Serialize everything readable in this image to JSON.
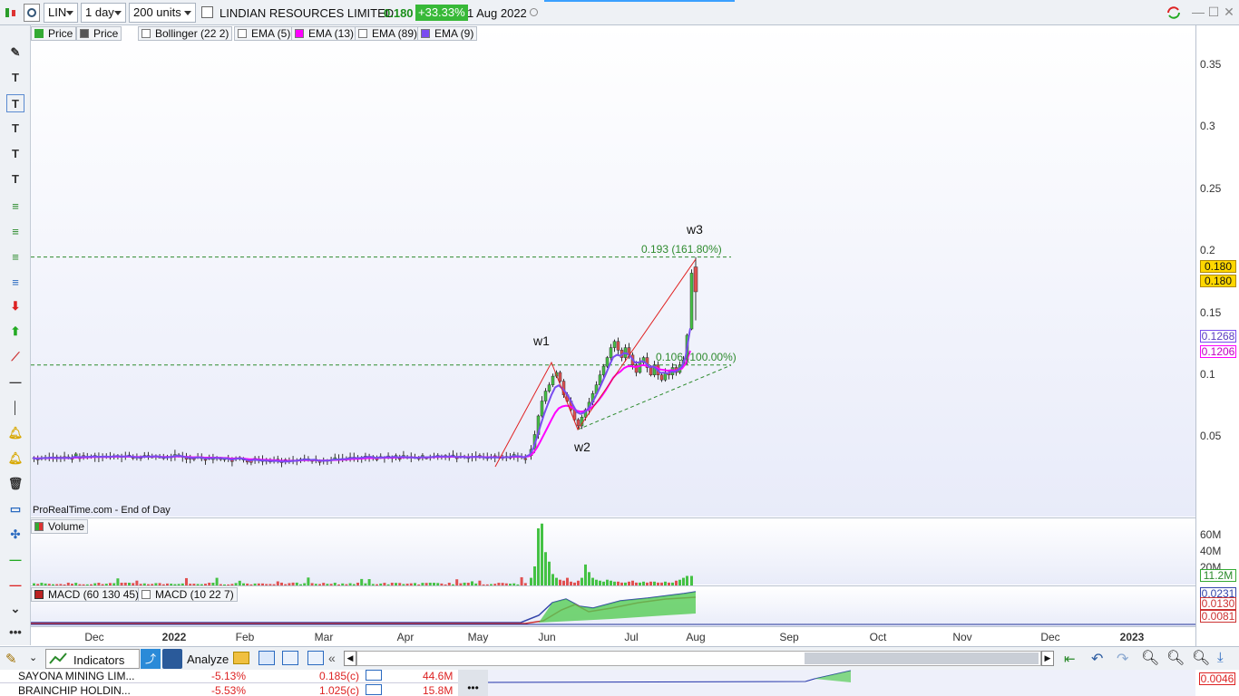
{
  "toolbar": {
    "symbol": "LIN",
    "interval": "1 day",
    "units": "200 units",
    "instrument_name": "LINDIAN RESOURCES LIMITED",
    "last_price": "0.180",
    "change_pct": "+33.33%",
    "date": "1 Aug 2022"
  },
  "chart_legend": [
    "Price",
    "Price",
    "Bollinger (22 2)",
    "EMA (5)",
    "EMA (13)",
    "EMA (89)",
    "EMA (9)"
  ],
  "source_label": "ProRealTime.com - End of Day",
  "volume_panel": {
    "label": "Volume",
    "axis_labels": [
      "60M",
      "40M",
      "20M"
    ],
    "current_tag": "11.2M"
  },
  "macd_panel": {
    "labels": [
      "MACD (60 130 45)",
      "MACD (10 22 7)"
    ],
    "tags": [
      "0.0231",
      "0.0130",
      "0.0081"
    ]
  },
  "annotations": {
    "w1": "w1",
    "w2": "w2",
    "w3": "w3",
    "fib_upper": "0.193 (161.80%)",
    "fib_lower": "0.106 (100.00%)"
  },
  "price_tags": {
    "last1": "0.180",
    "last2": "0.180",
    "ema1": "0.1268",
    "ema2": "0.1206"
  },
  "bottom_toolbar": {
    "indicators": "Indicators",
    "analyze": "Analyze"
  },
  "watchlist": [
    {
      "name": "SAYONA MINING LIM...",
      "change": "-5.13%",
      "price": "0.185(c)",
      "volume": "44.6M"
    },
    {
      "name": "BRAINCHIP HOLDIN...",
      "change": "-5.53%",
      "price": "1.025(c)",
      "volume": "15.8M"
    }
  ],
  "secondary_tag": "0.0046",
  "colors": {
    "ema5": "#7a4cf0",
    "ema13": "#ff00ff",
    "up": "#44c244",
    "down": "#e05050",
    "fib": "#2e8b2e",
    "wave": "#e02020",
    "highlight_tag": "#ffd700"
  },
  "chart_data": {
    "type": "line",
    "title": "LINDIAN RESOURCES LIMITED",
    "x_labels": [
      "Dec",
      "2022",
      "Feb",
      "Mar",
      "Apr",
      "May",
      "Jun",
      "Jul",
      "Aug",
      "Sep",
      "Oct",
      "Nov",
      "Dec",
      "2023"
    ],
    "y_ticks": [
      "0.35",
      "0.3",
      "0.25",
      "0.2",
      "0.15",
      "0.1",
      "0.05"
    ],
    "ylim": [
      0,
      0.38
    ],
    "series": [
      {
        "name": "EMA (5)",
        "values": [
          0.032,
          0.032,
          0.031,
          0.032,
          0.031,
          0.032,
          0.034,
          0.033,
          0.034,
          0.032,
          0.033,
          0.078,
          0.062,
          0.105,
          0.112,
          0.103,
          0.127
        ]
      },
      {
        "name": "EMA (13)",
        "values": [
          0.031,
          0.032,
          0.031,
          0.031,
          0.031,
          0.032,
          0.033,
          0.033,
          0.033,
          0.032,
          0.032,
          0.072,
          0.06,
          0.1,
          0.108,
          0.101,
          0.121
        ]
      }
    ],
    "dates": [
      "2021-11",
      "2021-12",
      "2022-01",
      "2022-02",
      "2022-03",
      "2022-04",
      "2022-04-20",
      "2022-05",
      "2022-05-15",
      "2022-05-25",
      "2022-05-28",
      "2022-06-05",
      "2022-06-15",
      "2022-06-30",
      "2022-07-10",
      "2022-07-20",
      "2022-08-01"
    ],
    "levels": [
      {
        "label": "0.193 (161.80%)",
        "value": 0.193
      },
      {
        "label": "0.106 (100.00%)",
        "value": 0.106
      }
    ]
  }
}
